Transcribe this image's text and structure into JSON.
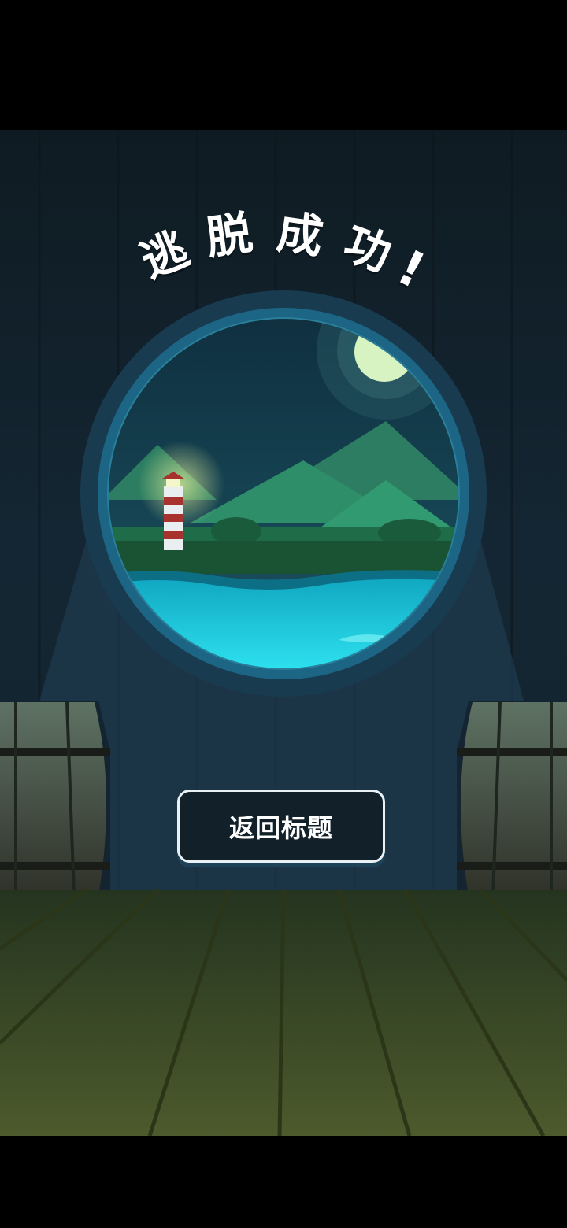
{
  "title": {
    "chars": [
      "逃",
      "脱",
      "成",
      "功",
      "!"
    ]
  },
  "buttons": {
    "return_title": "返回标题"
  },
  "colors": {
    "button_border": "#e9f1f4",
    "water": "#1fc6dc",
    "porthole_rim": "#1d5f7c",
    "floor": "#3b4a26"
  }
}
